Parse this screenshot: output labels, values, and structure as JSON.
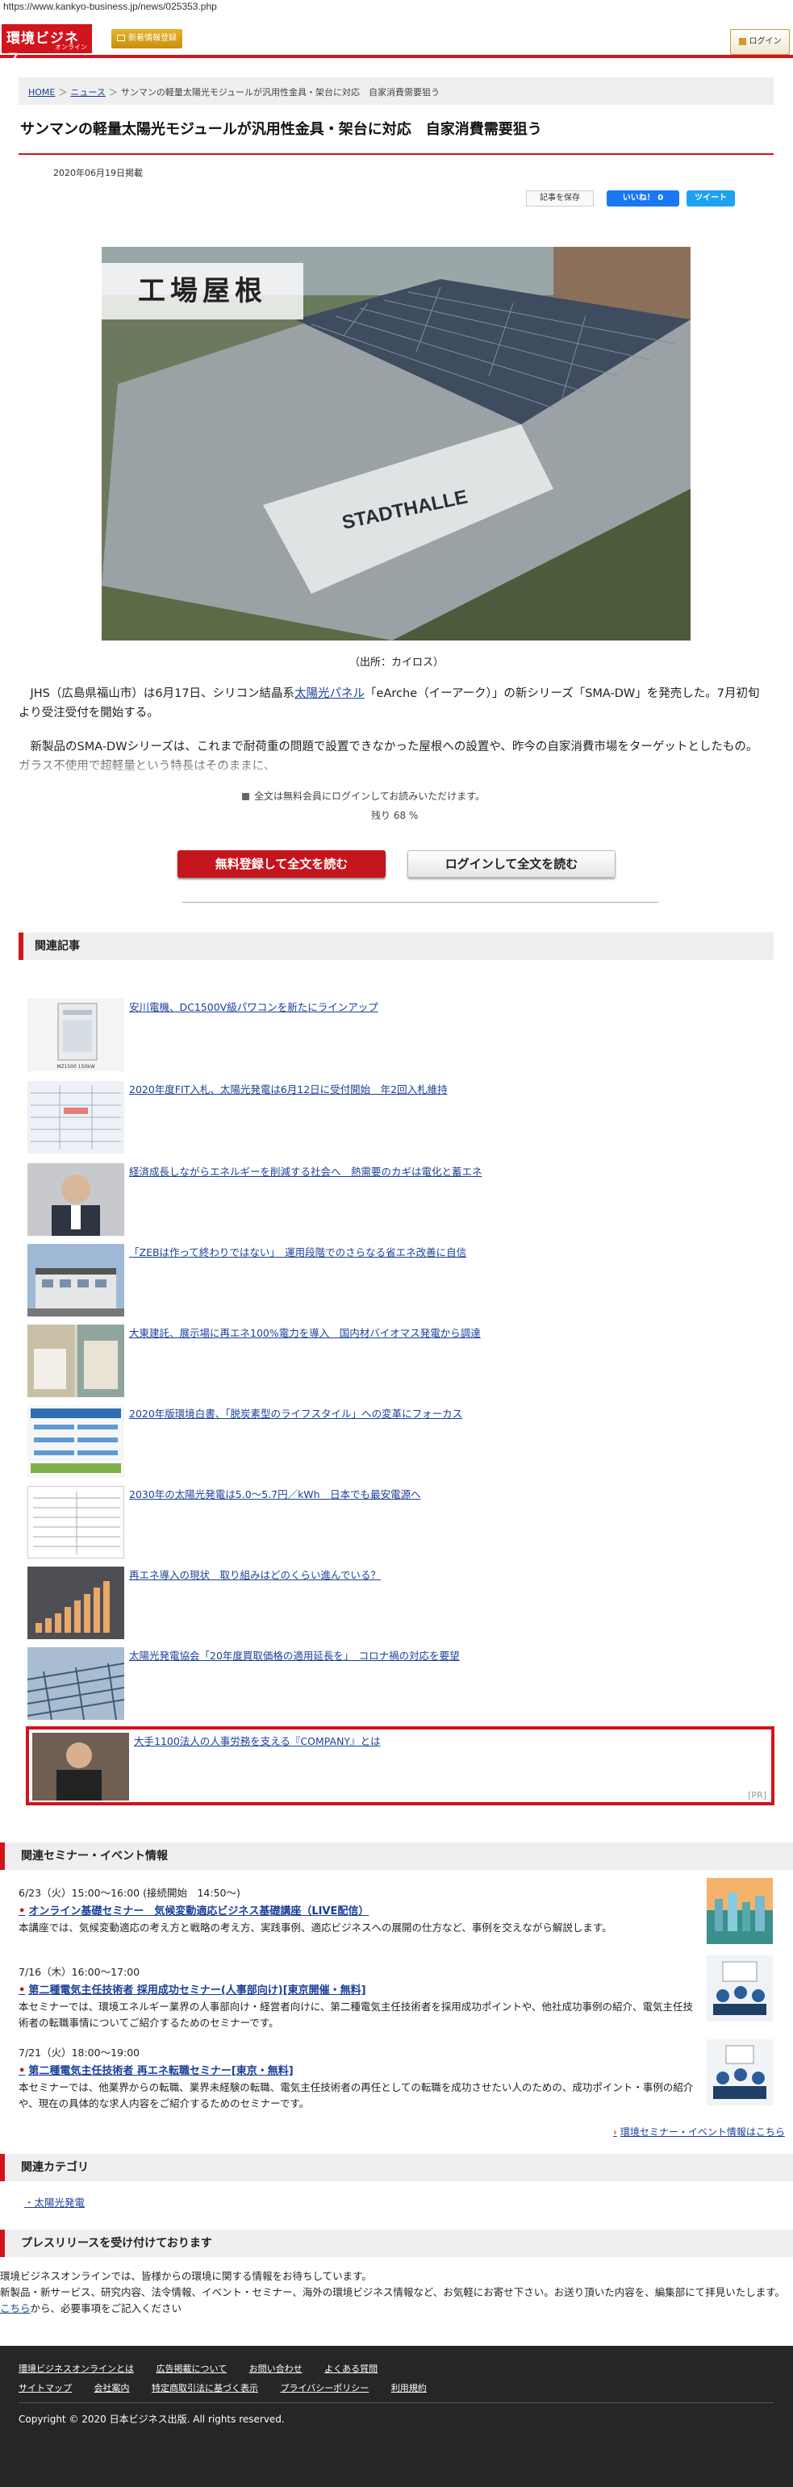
{
  "browser": {
    "url": "https://www.kankyo-business.jp/news/025353.php"
  },
  "header": {
    "logo_main": "環境ビジネス",
    "logo_sub": "オンライン",
    "newsletter_label": "新着情報登録",
    "login_label": "ログイン"
  },
  "breadcrumb": {
    "home": "HOME",
    "news": "ニュース",
    "current": "サンマンの軽量太陽光モジュールが汎用性金具・架台に対応　自家消費需要狙う"
  },
  "article": {
    "title": "サンマンの軽量太陽光モジュールが汎用性金具・架台に対応　自家消費需要狙う",
    "date": "2020年06月19日掲載",
    "save_label": "記事を保存",
    "like_label": "いいね！ 0",
    "tweet_label": "ツイート",
    "photo_label": "工場屋根",
    "photo_wall_text": "STADTHALLE",
    "caption": "（出所：カイロス）",
    "para1_a": "JHS（広島県福山市）は6月17日、シリコン結晶系",
    "para1_link": "太陽光パネル",
    "para1_b": "「eArche（イーアーク）」の新シリーズ「SMA-DW」を発売した。7月初旬より受注受付を開始する。",
    "para2": "新製品のSMA-DWシリーズは、これまで耐荷重の問題で設置できなかった屋根への設置や、昨今の自家消費市場をターゲットとしたもの。ガラス不使用で超軽量という特長はそのままに、",
    "member_note": "全文は無料会員にログインしてお読みいただけます。",
    "remain": "残り 68 %",
    "register_label": "無料登録して全文を読む",
    "login_read_label": "ログインして全文を読む"
  },
  "related": {
    "heading": "関連記事",
    "items": [
      {
        "title": "安川電機、DC1500V級パワコンを新たにラインアップ",
        "thumb_text": "MZ1500 150kW"
      },
      {
        "title": "2020年度FIT入札、太陽光発電は6月12日に受付開始　年2回入札維持"
      },
      {
        "title": "経済成長しながらエネルギーを削減する社会へ　熱需要のカギは電化と蓄エネ"
      },
      {
        "title": "「ZEBは作って終わりではない」　運用段階でのさらなる省エネ改善に自信"
      },
      {
        "title": "大東建託、展示場に再エネ100%電力を導入　国内材バイオマス発電から調達"
      },
      {
        "title": "2020年版環境白書、「脱炭素型のライフスタイル」への変革にフォーカス"
      },
      {
        "title": "2030年の太陽光発電は5.0～5.7円／kWh　日本でも最安電源へ"
      },
      {
        "title": "再エネ導入の現状　取り組みはどのくらい進んでいる？"
      },
      {
        "title": "太陽光発電協会「20年度買取価格の適用延長を」　コロナ禍の対応を要望"
      }
    ],
    "pr": {
      "title": "大手1100法人の人事労務を支える『COMPANY』とは",
      "tag": "[PR]"
    }
  },
  "seminars": {
    "heading": "関連セミナー・イベント情報",
    "items": [
      {
        "date": "6/23（火）15:00～16:00 (接続開始　14:50～)",
        "title": "オンライン基礎セミナー　気候変動適応ビジネス基礎講座（LIVE配信）",
        "desc": "本講座では、気候変動適応の考え方と戦略の考え方、実践事例、適応ビジネスへの展開の仕方など、事例を交えながら解説します。"
      },
      {
        "date": "7/16（木）16:00～17:00",
        "title": "第二種電気主任技術者 採用成功セミナー(人事部向け)[東京開催・無料]",
        "desc": "本セミナーでは、環境エネルギー業界の人事部向け・経営者向けに、第二種電気主任技術者を採用成功ポイントや、他社成功事例の紹介、電気主任技術者の転職事情についてご紹介するためのセミナーです。"
      },
      {
        "date": "7/21（火）18:00～19:00",
        "title": "第二種電気主任技術者 再エネ転職セミナー[東京・無料]",
        "desc": "本セミナーでは、他業界からの転職、業界未経験の転職、電気主任技術者の再任としての転職を成功させたい人のための、成功ポイント・事例の紹介や、現在の具体的な求人内容をご紹介するためのセミナーです。"
      }
    ],
    "more_label": "環境セミナー・イベント情報はこちら"
  },
  "categories": {
    "heading": "関連カテゴリ",
    "items": [
      "太陽光発電"
    ]
  },
  "press": {
    "heading": "プレスリリースを受け付けております",
    "line1": "環境ビジネスオンラインでは、皆様からの環境に関する情報をお待ちしています。",
    "line2": "新製品・新サービス、研究内容、法令情報、イベント・セミナー、海外の環境ビジネス情報など、お気軽にお寄せ下さい。お送り頂いた内容を、編集部にて拝見いたします。",
    "link": "こちら",
    "line3": "から、必要事項をご記入ください"
  },
  "footer": {
    "row1": [
      "環境ビジネスオンラインとは",
      "広告掲載について",
      "お問い合わせ",
      "よくある質問"
    ],
    "row2": [
      "サイトマップ",
      "会社案内",
      "特定商取引法に基づく表示",
      "プライバシーポリシー",
      "利用規約"
    ],
    "copyright": "Copyright © 2020 日本ビジネス出版. All rights reserved."
  }
}
